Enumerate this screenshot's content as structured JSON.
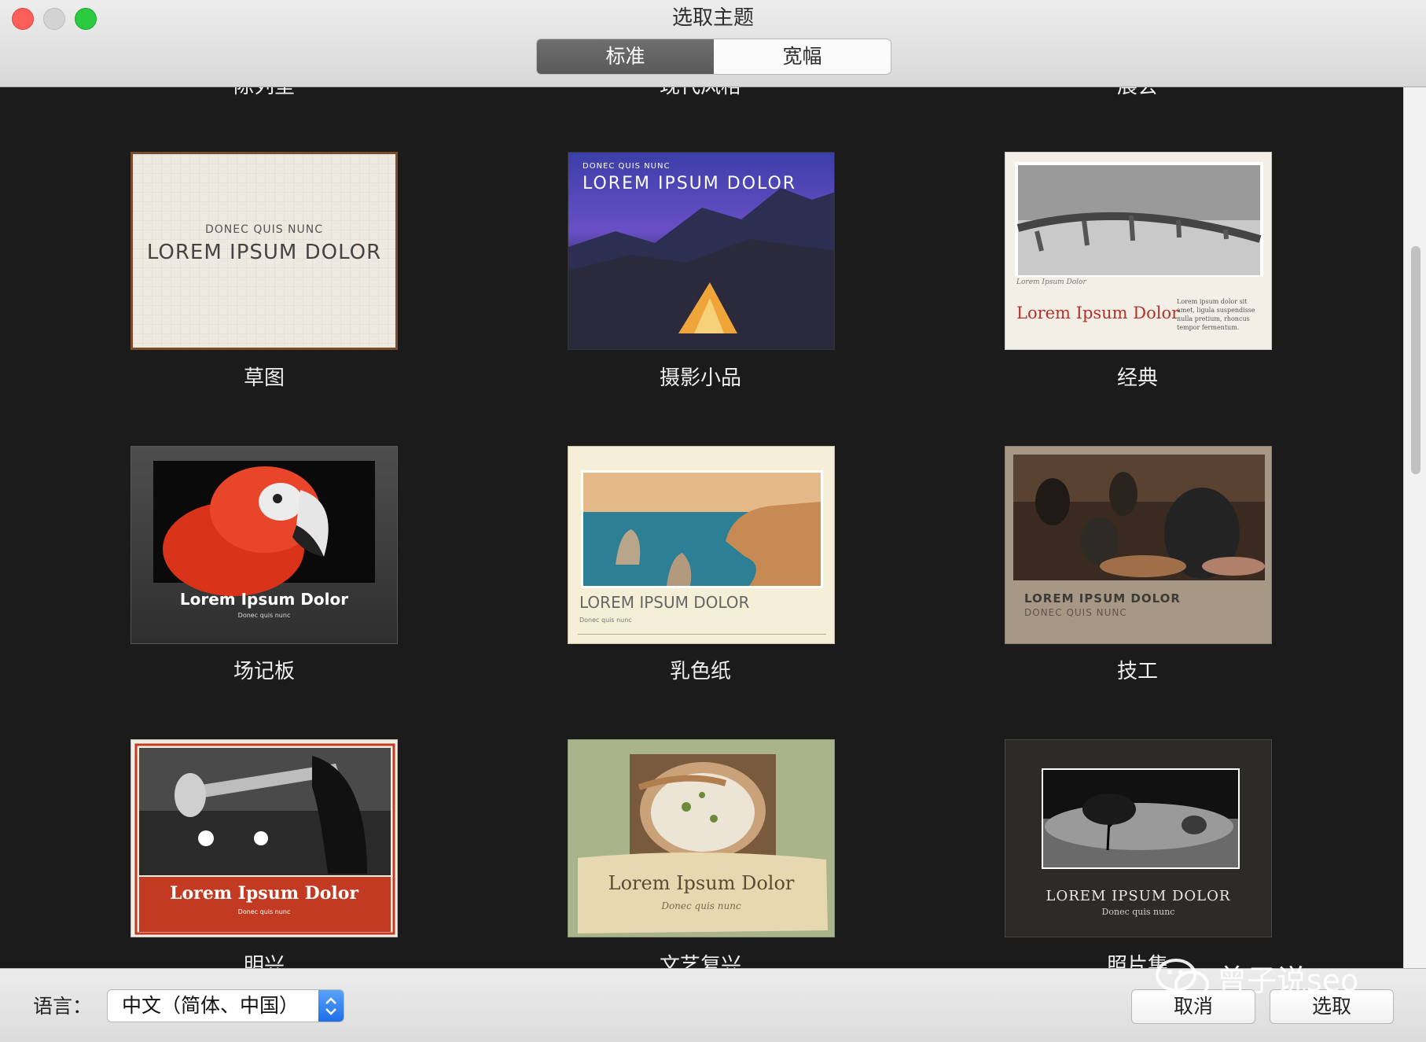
{
  "window": {
    "title": "选取主题"
  },
  "segmented": {
    "standard": "标准",
    "wide": "宽幅"
  },
  "row0": [
    "陈列室",
    "现代风格",
    "展会"
  ],
  "themes": [
    {
      "name": "草图",
      "sub": "DONEC QUIS NUNC",
      "title": "LOREM IPSUM DOLOR"
    },
    {
      "name": "摄影小品",
      "sub": "DONEC QUIS NUNC",
      "title": "LOREM IPSUM DOLOR"
    },
    {
      "name": "经典",
      "sub": "Lorem Ipsum Dolor",
      "title": "Lorem Ipsum Dolor",
      "body": "Lorem ipsum dolor sit amet, ligula suspendisse nulla pretium, rhoncus tempor fermentum."
    },
    {
      "name": "场记板",
      "title": "Lorem Ipsum Dolor",
      "sub": "Donec quis nunc"
    },
    {
      "name": "乳色纸",
      "title": "LOREM IPSUM DOLOR",
      "sub": "Donec quis nunc"
    },
    {
      "name": "技工",
      "title": "LOREM IPSUM DOLOR",
      "sub": "DONEC QUIS NUNC"
    },
    {
      "name": "明兴",
      "title": "Lorem Ipsum Dolor",
      "sub": "Donec quis nunc"
    },
    {
      "name": "文艺复兴",
      "title": "Lorem Ipsum Dolor",
      "sub": "Donec quis nunc"
    },
    {
      "name": "照片集",
      "title": "LOREM IPSUM DOLOR",
      "sub": "Donec quis nunc"
    }
  ],
  "footer": {
    "language_label": "语言：",
    "language_value": "中文（简体、中国）",
    "cancel": "取消",
    "choose": "选取"
  },
  "watermark": "曾子说seo"
}
